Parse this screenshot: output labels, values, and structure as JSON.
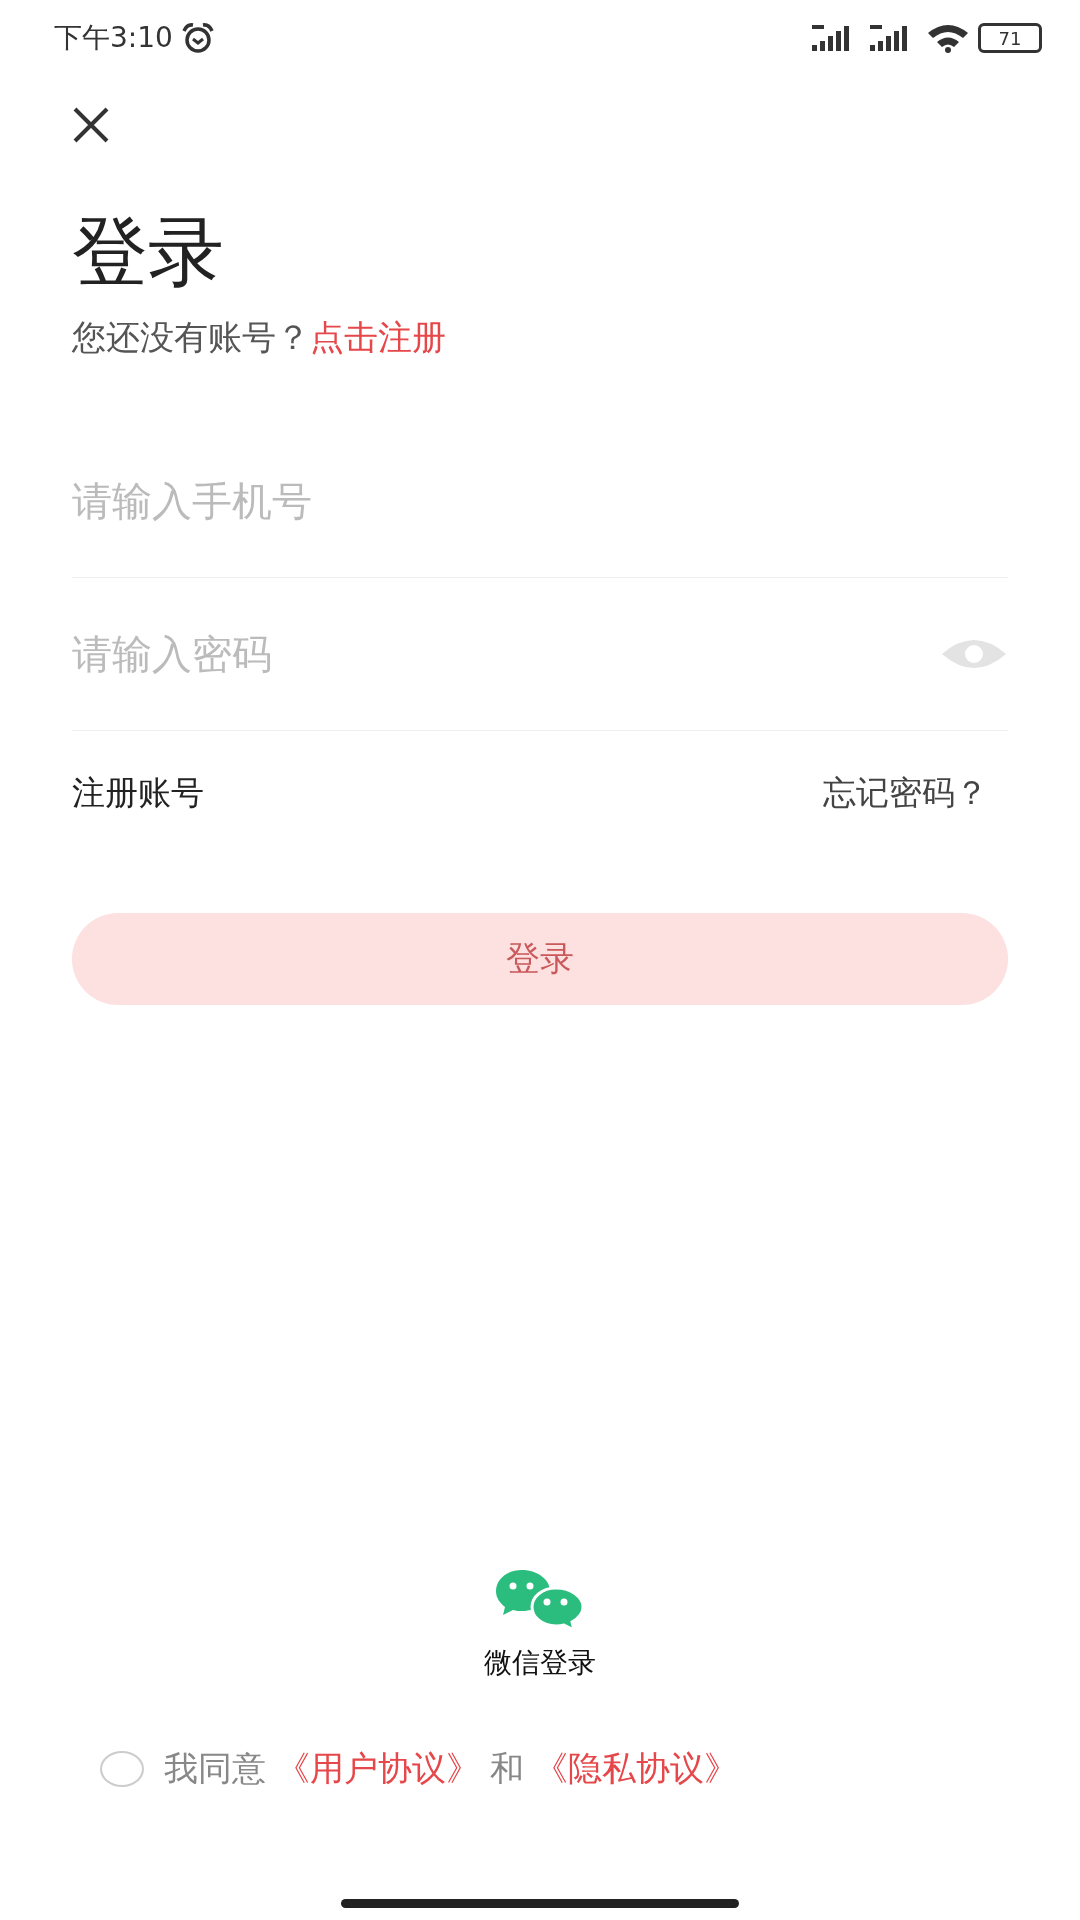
{
  "status_bar": {
    "time": "下午3:10",
    "battery": "71"
  },
  "title": "登录",
  "subtitle": {
    "text": "您还没有账号？",
    "link": "点击注册"
  },
  "phone_field": {
    "placeholder": "请输入手机号"
  },
  "password_field": {
    "placeholder": "请输入密码"
  },
  "links": {
    "register": "注册账号",
    "forgot": "忘记密码？"
  },
  "login_button": {
    "label": "登录",
    "disabled": true
  },
  "wechat_login": {
    "label": "微信登录"
  },
  "agreement": {
    "checked": false,
    "prefix": "我同意",
    "user_agreement": "《用户协议》",
    "and": "和",
    "privacy": "《隐私协议》"
  }
}
